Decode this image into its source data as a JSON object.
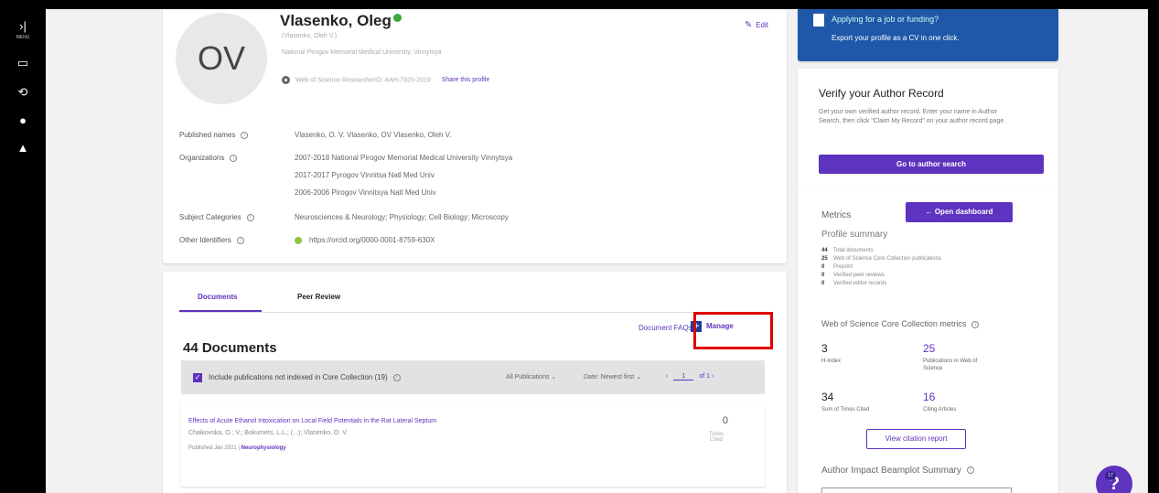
{
  "leftbar": {
    "expand_label": "MENU"
  },
  "profile": {
    "initials": "OV",
    "name": "Vlasenko, Oleg",
    "native_name": "(Vlasenko, Oleh V.)",
    "institution": "National Pirogov Memorial Medical University, Vinnytsya",
    "researcher_id": "Web of Science ResearcherID: AAH-7920-2019",
    "share_label": "Share this profile",
    "edit_label": "Edit",
    "rows": {
      "published_names_label": "Published names",
      "published_names_value": "Vlasenko, O. V.    Vlasenko, OV    Vlasenko, Oleh V.",
      "organizations_label": "Organizations",
      "org1": "2007-2018    National Pirogov Memorial Medical University Vinnytsya",
      "org2": "2017-2017    Pyrogov Vinnitsa Natl Med Univ",
      "org3": "2006-2006    Pirogov Vinnitsya Natl Med Univ",
      "subject_label": "Subject Categories",
      "subject_value": "Neurosciences & Neurology; Physiology; Cell Biology; Microscopy",
      "other_ids_label": "Other Identifiers",
      "other_ids_value": "https://orcid.org/0000-0001-8759-630X"
    }
  },
  "documents": {
    "tab_documents": "Documents",
    "tab_peer_review": "Peer Review",
    "faqs_label": "Document FAQs",
    "manage_label": "Manage",
    "count_heading": "44 Documents",
    "include_label": "Include publications not indexed in Core Collection (19)",
    "all_pubs": "All Publications",
    "date_sort": "Date: Newest first",
    "page_current": "1",
    "page_total": "of 1",
    "item1": {
      "title": "Effects of Acute Ethanol Intoxication on Local Field Potentials in the Rat Lateral Septum",
      "authors": "Chaikovska, O.; V.; Bokumets, L.L.; (...); Vlasenko, O. V.",
      "published": "Published Jan 2021 |",
      "journal": "Neurophysiology",
      "cites": "0",
      "cites_label": "Times Cited"
    }
  },
  "banner": {
    "title": "Applying for a job or funding?",
    "text": "Export your profile as a CV in one click."
  },
  "verify": {
    "title": "Verify your Author Record",
    "text": "Get your own verified author record. Enter your name in Author Search, then click \"Claim My Record\" on your author record page.",
    "button": "Go to author search"
  },
  "metrics": {
    "title": "Metrics",
    "dashboard_button": "Open dashboard",
    "summary_title": "Profile summary",
    "summary": [
      {
        "n": "44",
        "label": "Total documents"
      },
      {
        "n": "25",
        "label": "Web of Science Core Collection publications"
      },
      {
        "n": "0",
        "label": "Preprint"
      },
      {
        "n": "0",
        "label": "Verified peer reviews"
      },
      {
        "n": "0",
        "label": "Verified editor records"
      }
    ],
    "wos_title": "Web of Science Core Collection metrics",
    "h_index": "3",
    "h_index_label": "H-Index",
    "pubs_wos": "25",
    "pubs_wos_label": "Publications in Web of Science",
    "sum_cited": "34",
    "sum_cited_label": "Sum of Times Cited",
    "citing": "16",
    "citing_label": "Citing Articles",
    "view_report": "View citation report",
    "beamplot_title": "Author Impact Beamplot Summary"
  },
  "help": {
    "label": "?",
    "badge": "17"
  }
}
